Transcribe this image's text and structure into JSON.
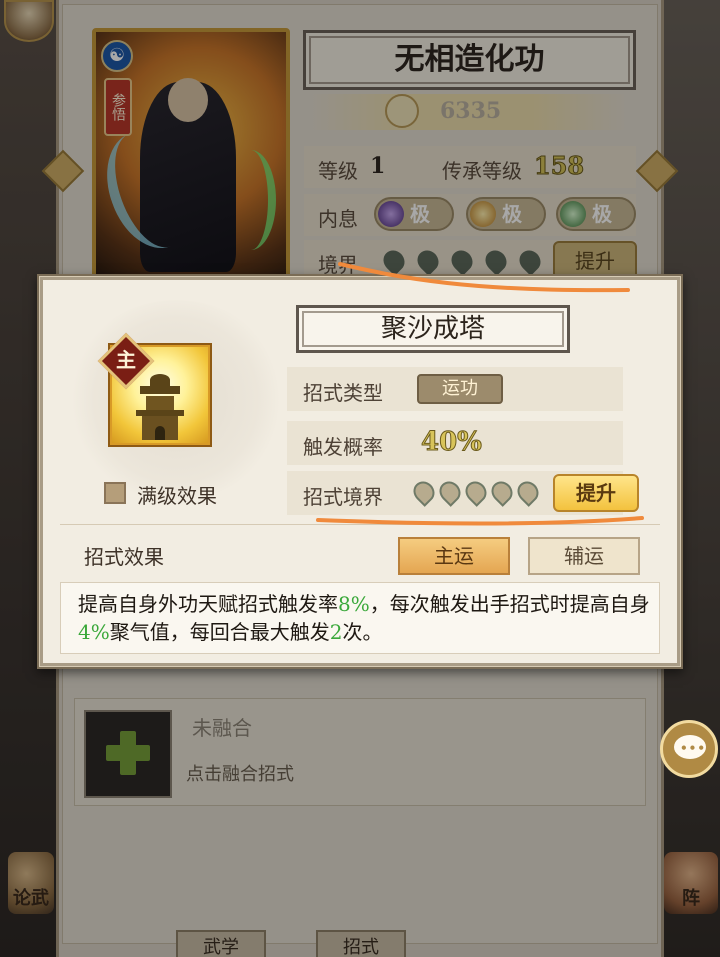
{
  "background": {
    "hero": {
      "badge_icon": "yin-yang-icon",
      "tag": "参悟"
    },
    "title": "无相造化功",
    "power": "6335",
    "level_label": "等级",
    "level_value": "1",
    "inherit_label": "传承等级",
    "inherit_value": "158",
    "neixi_label": "内息",
    "neixi": [
      "极",
      "极",
      "极"
    ],
    "realm_label": "境界",
    "realm_button": "提升",
    "fuse_title": "未融合",
    "fuse_hint": "点击融合招式",
    "left_button": "论武",
    "right_button": "阵",
    "bottom_tabs": [
      "武学",
      "招式"
    ]
  },
  "popup": {
    "badge": "主",
    "skill_name": "聚沙成塔",
    "max_level_label": "满级效果",
    "type_label": "招式类型",
    "type_value": "运功",
    "rate_label": "触发概率",
    "rate_value": "40%",
    "realm_label": "招式境界",
    "realm_level": 5,
    "realm_max": 5,
    "upgrade_button": "提升",
    "effect_label": "招式效果",
    "tab_main": "主运",
    "tab_assist": "辅运",
    "desc": {
      "p1": "提高自身外功天赋招式触发率",
      "v1": "8%",
      "p2": "，每次触发出手招式时提高自身",
      "v2": "4%",
      "p3": "聚气值，每回合最大触发",
      "v3": "2",
      "p4": "次。"
    }
  },
  "colors": {
    "accent_gold": "#f3c23e",
    "highlight_green": "#3aa83a",
    "annotation": "#f08a3c"
  }
}
